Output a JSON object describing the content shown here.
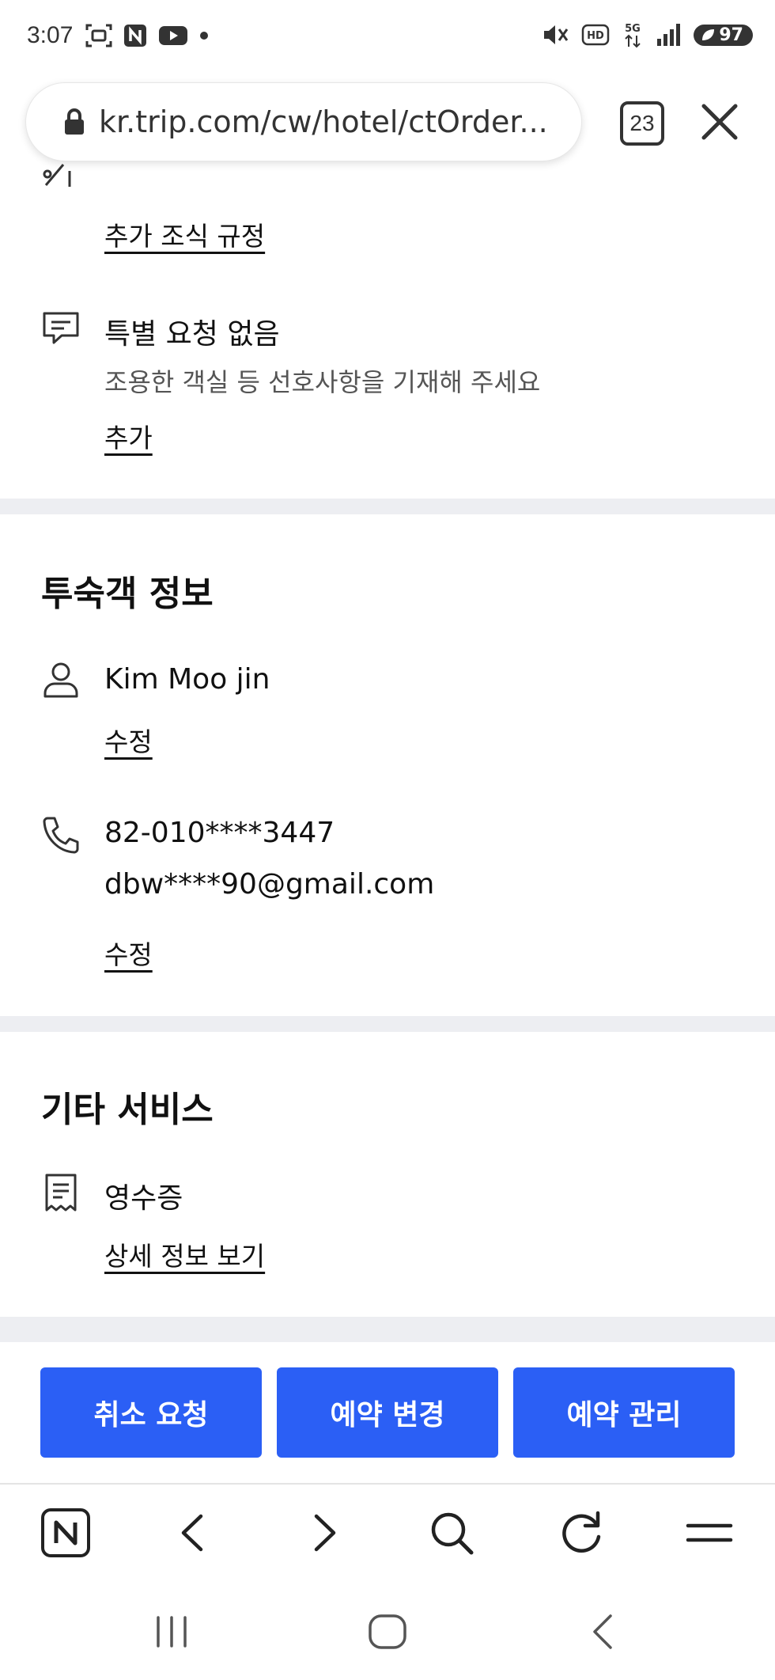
{
  "status_bar": {
    "time": "3:07",
    "battery": "97"
  },
  "browser": {
    "url": "kr.trip.com/cw/hotel/ctOrder...",
    "tab_count": "23"
  },
  "top_partial": {
    "link": "추가 조식 규정"
  },
  "special_request": {
    "title": "특별 요청 없음",
    "subtitle": "조용한 객실 등 선호사항을 기재해 주세요",
    "link": "추가"
  },
  "guest_info": {
    "heading": "투숙객 정보",
    "name": "Kim Moo jin",
    "name_edit": "수정",
    "phone": "82-010****3447",
    "email": "dbw****90@gmail.com",
    "contact_edit": "수정"
  },
  "other_services": {
    "heading": "기타 서비스",
    "receipt_title": "영수증",
    "receipt_link": "상세 정보 보기"
  },
  "actions": {
    "cancel": "취소 요청",
    "change": "예약 변경",
    "manage": "예약 관리"
  },
  "colors": {
    "accent": "#2b5ff5",
    "divider": "#edeef2"
  }
}
